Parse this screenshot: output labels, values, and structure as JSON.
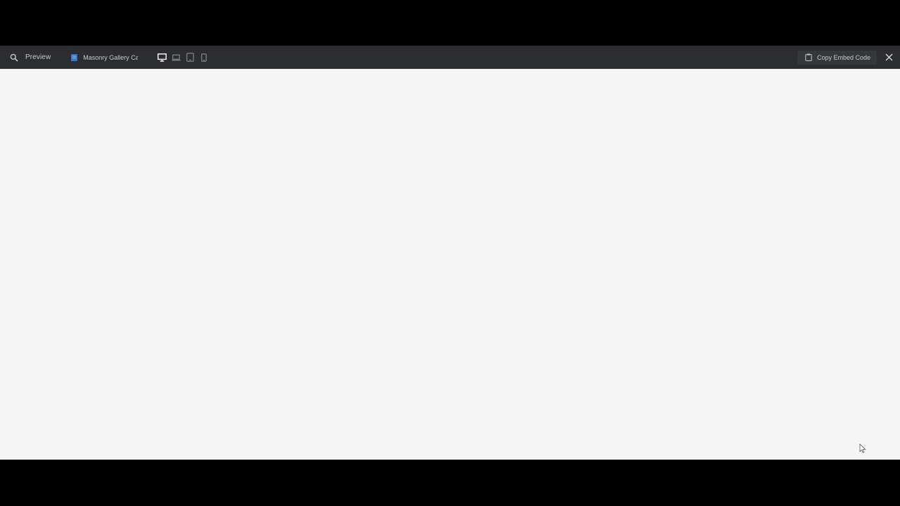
{
  "toolbar": {
    "search_icon": "search-icon",
    "preview_label": "Preview",
    "project": {
      "icon": "document-icon",
      "label": "Masonry Gallery Ca",
      "icon_color": "#2f7bd6"
    },
    "devices": [
      {
        "name": "desktop",
        "icon": "monitor-icon",
        "active": true
      },
      {
        "name": "laptop",
        "icon": "laptop-icon",
        "active": false
      },
      {
        "name": "tablet",
        "icon": "tablet-icon",
        "active": false
      },
      {
        "name": "mobile",
        "icon": "phone-icon",
        "active": false
      }
    ],
    "embed_button": {
      "icon": "clipboard-icon",
      "label": "Copy Embed Code"
    },
    "close_icon": "close-icon"
  },
  "colors": {
    "toolbar_bg": "#2b2d30",
    "canvas_bg": "#f5f5f5",
    "letterbox": "#000000",
    "accent": "#2f7bd6"
  }
}
